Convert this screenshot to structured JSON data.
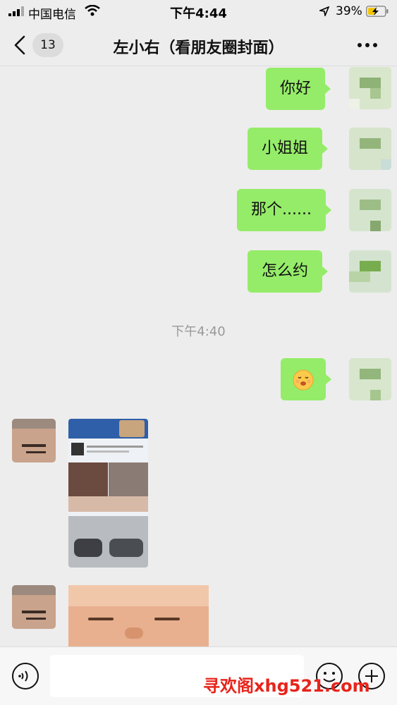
{
  "status_bar": {
    "carrier": "中国电信",
    "time": "下午4:44",
    "battery": "39%"
  },
  "nav": {
    "unread_count": "13",
    "title": "左小右（看朋友圈封面）"
  },
  "messages": [
    {
      "from": "me",
      "text": "你好"
    },
    {
      "from": "me",
      "text": "小姐姐"
    },
    {
      "from": "me",
      "text": "那个......"
    },
    {
      "from": "me",
      "text": "怎么约"
    },
    {
      "from": "divider",
      "text": "下午4:40"
    },
    {
      "from": "me",
      "type": "emoji",
      "emoji": "😶"
    },
    {
      "from": "friend",
      "type": "image",
      "description": "poster"
    },
    {
      "from": "friend",
      "type": "image",
      "description": "photo"
    }
  ],
  "input_bar": {
    "input_value": ""
  },
  "watermark": "寻欢阁xhg521.com",
  "colors": {
    "bubble_sent": "#95ec69",
    "background": "#ededed"
  }
}
